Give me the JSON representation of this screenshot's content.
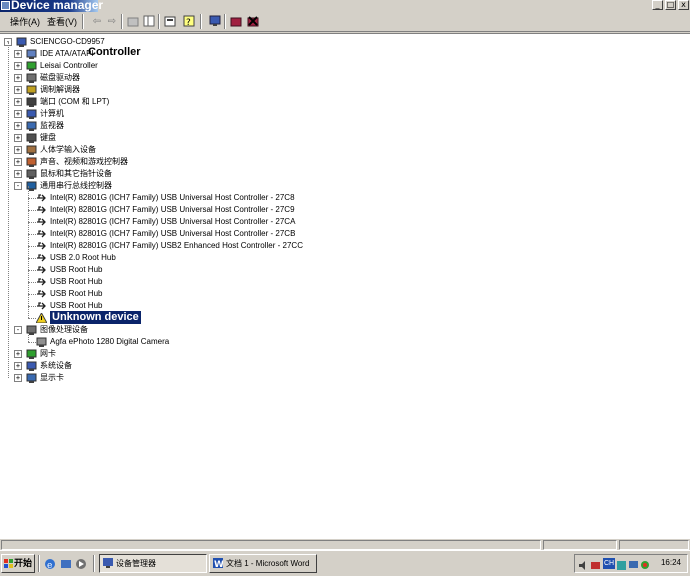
{
  "window": {
    "title": "Device manager",
    "min_glyph": "_",
    "max_glyph": "□",
    "close_glyph": "x"
  },
  "menubar": {
    "action_label": "操作(A)",
    "view_label": "查看(V)"
  },
  "tree": {
    "root": "SCIENCGO-CD9957",
    "items": [
      {
        "label": "IDE ATA/ATAPI",
        "note": "Controller"
      },
      {
        "label": "Leisai Controller"
      },
      {
        "label": "磁盘驱动器"
      },
      {
        "label": "调制解调器"
      },
      {
        "label": "端口 (COM 和 LPT)"
      },
      {
        "label": "计算机"
      },
      {
        "label": "监视器"
      },
      {
        "label": "键盘"
      },
      {
        "label": "人体学输入设备"
      },
      {
        "label": "声音、视频和游戏控制器"
      },
      {
        "label": "鼠标和其它指针设备"
      },
      {
        "label": "通用串行总线控制器"
      }
    ],
    "usb_children": [
      "Intel(R) 82801G (ICH7 Family) USB Universal Host Controller - 27C8",
      "Intel(R) 82801G (ICH7 Family) USB Universal Host Controller - 27C9",
      "Intel(R) 82801G (ICH7 Family) USB Universal Host Controller - 27CA",
      "Intel(R) 82801G (ICH7 Family) USB Universal Host Controller - 27CB",
      "Intel(R) 82801G (ICH7 Family) USB2 Enhanced Host Controller - 27CC",
      "USB 2.0 Root Hub",
      "USB Root Hub",
      "USB Root Hub",
      "USB Root Hub",
      "USB Root Hub"
    ],
    "unknown_device": "Unknown device",
    "imaging": "图像处理设备",
    "camera": "Agfa ePhoto 1280 Digital Camera",
    "network": "网卡",
    "system": "系统设备",
    "display": "显示卡"
  },
  "taskbar": {
    "start_label": "开始",
    "task1": "设备管理器",
    "task2": "文档 1 - Microsoft Word",
    "clock": "16:24",
    "lang": "CH"
  },
  "colors": {
    "title_bg": "#0a246a",
    "highlight": "#0a246a",
    "face": "#d4d0c8"
  }
}
